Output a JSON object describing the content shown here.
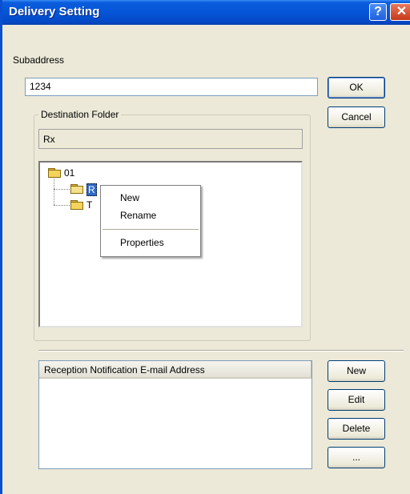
{
  "window": {
    "title": "Delivery Setting"
  },
  "subaddress": {
    "label": "Subaddress",
    "value": "1234"
  },
  "buttons": {
    "ok": "OK",
    "cancel": "Cancel",
    "new": "New",
    "edit": "Edit",
    "delete": "Delete",
    "more": "..."
  },
  "destination": {
    "group_label": "Destination Folder",
    "path_value": "Rx",
    "tree": [
      {
        "label": "01"
      },
      {
        "label": "R"
      },
      {
        "label": "T"
      }
    ]
  },
  "context_menu": {
    "items": [
      "New",
      "Rename",
      "Properties"
    ]
  },
  "email_list": {
    "header": "Reception Notification E-mail Address",
    "rows": []
  },
  "colors": {
    "titlebar": "#0655d8",
    "window_bg": "#ece9d8",
    "selection": "#316ac5"
  }
}
